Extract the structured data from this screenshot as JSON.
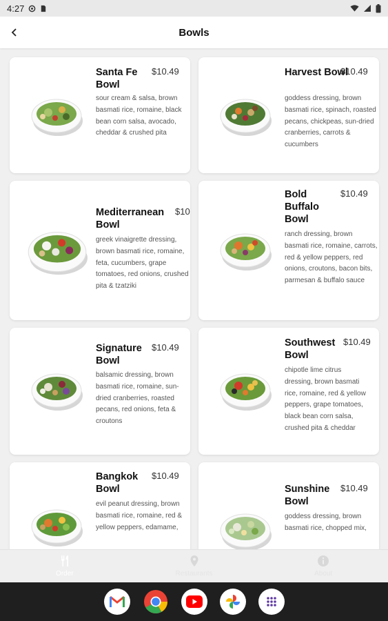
{
  "status_bar": {
    "time": "4:27"
  },
  "app_bar": {
    "title": "Bowls"
  },
  "bowls": [
    {
      "name": "Santa Fe Bowl",
      "price": "$10.49",
      "description": "sour cream & salsa, brown basmati rice, romaine, black bean corn salsa, avocado, cheddar & crushed pita"
    },
    {
      "name": "Harvest Bowl",
      "price": "$10.49",
      "description": "goddess dressing, brown basmati rice, spinach, roasted pecans, chickpeas, sun-dried cranberries, carrots & cucumbers"
    },
    {
      "name": "Mediterranean Bowl",
      "price": "$10",
      "description": "greek vinaigrette dressing, brown basmati rice, romaine, feta, cucumbers, grape tomatoes, red onions, crushed pita & tzatziki"
    },
    {
      "name": "Bold Buffalo Bowl",
      "price": "$10.49",
      "description": "ranch dressing, brown basmati rice, romaine, carrots, red & yellow peppers, red onions, croutons, bacon bits, parmesan & buffalo sauce"
    },
    {
      "name": "Signature Bowl",
      "price": "$10.49",
      "description": "balsamic dressing, brown basmati rice, romaine, sun-dried cranberries, roasted pecans, red onions, feta & croutons"
    },
    {
      "name": "Southwest Bowl",
      "price": "$10.49",
      "description": "chipotle lime citrus dressing, brown basmati rice, romaine, red & yellow peppers, grape tomatoes, black bean corn salsa, crushed pita & cheddar"
    },
    {
      "name": "Bangkok Bowl",
      "price": "$10.49",
      "description": "evil peanut dressing, brown basmati rice, romaine, red & yellow peppers, edamame,"
    },
    {
      "name": "Sunshine Bowl",
      "price": "$10.49",
      "description": "goddess dressing, brown basmati rice, chopped mix,"
    }
  ],
  "bottom_nav": [
    {
      "label": "Order",
      "icon": "fork-knife-icon"
    },
    {
      "label": "Restaurants",
      "icon": "location-pin-icon"
    },
    {
      "label": "About",
      "icon": "info-icon"
    }
  ],
  "dock_apps": [
    "gmail-icon",
    "chrome-icon",
    "youtube-icon",
    "photos-icon",
    "app-drawer-icon"
  ]
}
